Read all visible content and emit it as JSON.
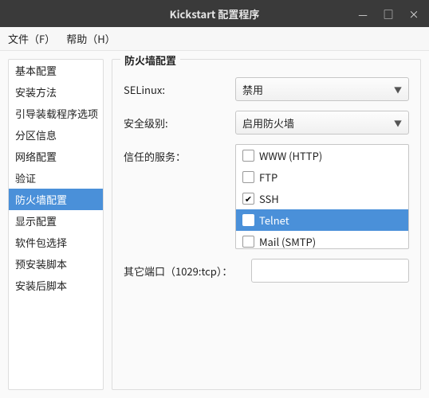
{
  "window": {
    "title": "Kickstart 配置程序",
    "controls": {
      "minimize": "—",
      "maximize": "□",
      "close": "×"
    }
  },
  "menubar": {
    "file": "文件（F）",
    "help": "帮助（H）"
  },
  "sidebar": {
    "items": [
      "基本配置",
      "安装方法",
      "引导装载程序选项",
      "分区信息",
      "网络配置",
      "验证",
      "防火墙配置",
      "显示配置",
      "软件包选择",
      "预安装脚本",
      "安装后脚本"
    ],
    "selected_index": 6
  },
  "panel": {
    "title": "防火墙配置",
    "selinux": {
      "label": "SELinux:",
      "value": "禁用"
    },
    "security_level": {
      "label": "安全级别:",
      "value": "启用防火墙"
    },
    "trusted_services": {
      "label": "信任的服务：",
      "items": [
        {
          "label": "WWW (HTTP)",
          "checked": false
        },
        {
          "label": "FTP",
          "checked": false
        },
        {
          "label": "SSH",
          "checked": true
        },
        {
          "label": "Telnet",
          "checked": false
        },
        {
          "label": "Mail (SMTP)",
          "checked": false
        }
      ],
      "selected_index": 3
    },
    "other_ports": {
      "label": "其它端口（1029:tcp）：",
      "value": ""
    }
  }
}
